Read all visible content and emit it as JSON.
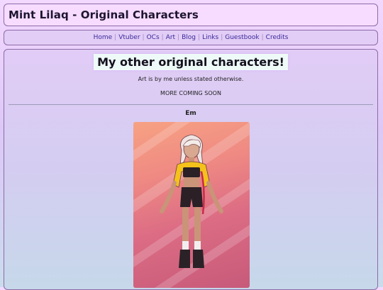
{
  "header": {
    "title": "Mint Lilaq - Original Characters"
  },
  "nav": {
    "items": [
      "Home",
      "Vtuber",
      "OCs",
      "Art",
      "Blog",
      "Links",
      "Guestbook",
      "Credits"
    ],
    "separator": "|"
  },
  "main": {
    "heading": "My other original characters!",
    "note": "Art is by me unless stated otherwise.",
    "coming_soon": "MORE COMING SOON",
    "characters": [
      {
        "name": "Em"
      }
    ]
  }
}
